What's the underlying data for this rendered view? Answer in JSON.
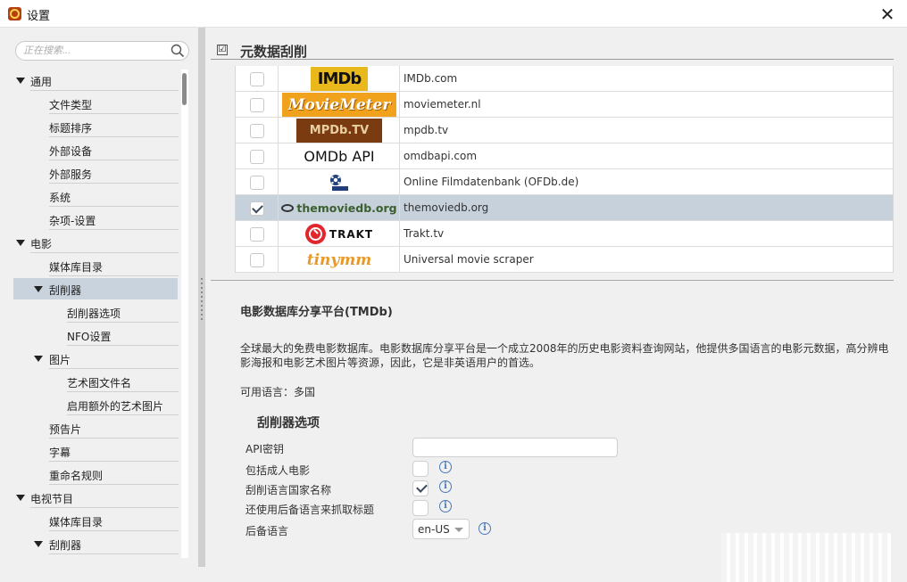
{
  "window": {
    "title": "设置",
    "close_glyph": "✕"
  },
  "search": {
    "placeholder": "正在搜索..."
  },
  "sidebar": {
    "items": [
      {
        "label": "通用",
        "expanded": true
      },
      {
        "label": "文件类型"
      },
      {
        "label": "标题排序"
      },
      {
        "label": "外部设备"
      },
      {
        "label": "外部服务"
      },
      {
        "label": "系统"
      },
      {
        "label": "杂项-设置"
      },
      {
        "label": "电影",
        "expanded": true
      },
      {
        "label": "媒体库目录"
      },
      {
        "label": "刮削器",
        "expanded": true,
        "selected": true
      },
      {
        "label": "刮削器选项"
      },
      {
        "label": "NFO设置"
      },
      {
        "label": "图片",
        "expanded": true
      },
      {
        "label": "艺术图文件名"
      },
      {
        "label": "启用额外的艺术图片"
      },
      {
        "label": "预告片"
      },
      {
        "label": "字幕"
      },
      {
        "label": "重命名规则"
      },
      {
        "label": "电视节目",
        "expanded": true
      },
      {
        "label": "媒体库目录"
      },
      {
        "label": "刮削器",
        "expanded": true
      }
    ]
  },
  "section": {
    "title": "元数据刮削",
    "checkbox_glyph": "☑"
  },
  "scrapers": [
    {
      "logo_text": "IMDb",
      "name": "IMDb.com",
      "checked": false
    },
    {
      "logo_text": "MovieMeter",
      "name": "moviemeter.nl",
      "checked": false
    },
    {
      "logo_text": "MPDb.TV",
      "name": "mpdb.tv",
      "checked": false
    },
    {
      "logo_text": "OMDb API",
      "name": "omdbapi.com",
      "checked": false
    },
    {
      "logo_text": "OFDb.de",
      "name": "Online Filmdatenbank (OFDb.de)",
      "checked": false
    },
    {
      "logo_text": "themoviedb.org",
      "name": "themoviedb.org",
      "checked": true,
      "selected": true
    },
    {
      "logo_text": "TRAKT",
      "name": "Trakt.tv",
      "checked": false
    },
    {
      "logo_text": "tinymm",
      "name": "Universal movie scraper",
      "checked": false
    }
  ],
  "detail": {
    "title": "电影数据库分享平台(TMDb)",
    "description": "全球最大的免费电影数据库。电影数据库分享平台是一个成立2008年的历史电影资料查询网站，他提供多国语言的电影元数据，高分辨电影海报和电影艺术图片等资源，因此，它是非英语用户的首选。",
    "languages": "可用语言：多国"
  },
  "options": {
    "title": "刮削器选项",
    "api_key_label": "API密钥",
    "api_key_value": "",
    "include_adult_label": "包括成人电影",
    "include_adult": false,
    "scrape_language_label": "刮削语言国家名称",
    "scrape_language": true,
    "fallback_title_label": "还使用后备语言来抓取标题",
    "fallback_title": false,
    "fallback_language_label": "后备语言",
    "fallback_language_value": "en-US",
    "info_glyph": "i"
  },
  "colors": {
    "selection": "#c6d1dc",
    "imdb_yellow": "#e8b81c",
    "trakt_red": "#e1262d",
    "info_blue": "#4a7ab6"
  }
}
